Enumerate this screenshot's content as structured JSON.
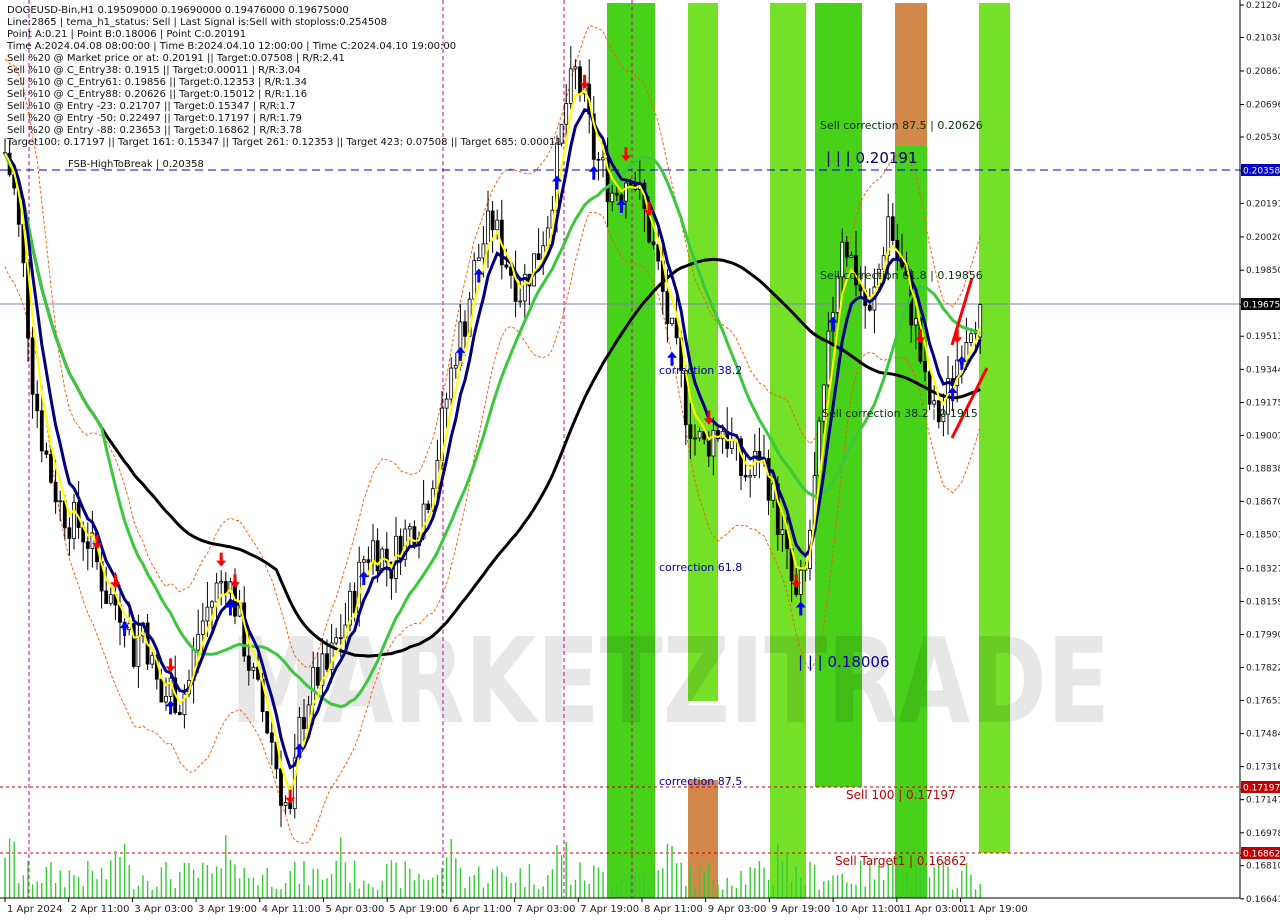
{
  "header": {
    "lines": [
      "DOGEUSD-Bin,H1  0.19509000 0.19690000 0.19476000 0.19675000",
      "Line:2865 | tema_h1_status: Sell | Last Signal is:Sell with stoploss:0.254508",
      "Point A:0.21 | Point B:0.18006 | Point C:0.20191",
      "Time A:2024.04.08 08:00:00 | Time B:2024.04.10 12:00:00 | Time C:2024.04.10 19:00:00",
      "Sell %20 @ Market price or at: 0.20191 || Target:0.07508 | R/R:2.41",
      "Sell %10 @ C_Entry38: 0.1915 || Target:0.00011 | R/R:3.04",
      "Sell %10 @ C_Entry61: 0.19856 || Target:0.12353 | R/R:1.34",
      "Sell %10 @ C_Entry88: 0.20626 || Target:0.15012 | R/R:1.16",
      "Sell %10 @ Entry -23: 0.21707 || Target:0.15347 | R/R:1.7",
      "Sell %20 @ Entry -50: 0.22497 || Target:0.17197 | R/R:1.79",
      "Sell %20 @ Entry -88: 0.23653 || Target:0.16862 | R/R:3.78",
      "Target100: 0.17197 || Target 161: 0.15347 || Target 261: 0.12353 || Target 423: 0.07508 || Target 685: 0.00011"
    ]
  },
  "annotations": {
    "fsb": "FSB-HighToBreak | 0.20358",
    "point_c": "| | | 0.20191",
    "point_b": "| | | 0.18006",
    "sell_corr_875": "Sell correction 87.5 | 0.20626",
    "sell_corr_618": "Sell correction 61.8 | 0.19856",
    "sell_corr_382": "Sell correction 38.2 | 0.1915",
    "corr_382": "correction 38.2",
    "corr_618": "correction 61.8",
    "corr_875": "correction 87.5",
    "sell_100": "Sell 100 | 0.17197",
    "sell_target1": "Sell Target1 | 0.16862",
    "watermark": "MARKETZITRADE"
  },
  "colors": {
    "background": "#ffffff",
    "bull_candle": "#000000",
    "bear_candle": "#000000",
    "zone_green": "#33cc00",
    "zone_light_green": "#66dd11",
    "zone_orange": "#d2884a",
    "ma_black": "#000000",
    "ma_navy": "#000080",
    "ma_green": "#3cc83c",
    "ma_yellow": "#ffff00",
    "envelope_orange": "#ff5500",
    "dashed_blue": "#0000cc",
    "sell_line": "#c00000",
    "arrow_up": "#0000ff",
    "arrow_down": "#ff0000",
    "price_tag": "#333333",
    "current_tag": "#000000",
    "fsb_tag": "#0000cc",
    "red_tag": "#c00000"
  },
  "chart_data": {
    "type": "candlestick",
    "symbol": "DOGEUSD-Bin",
    "timeframe": "H1",
    "ylim": [
      0.16645,
      0.21204
    ],
    "y_ticks": [
      "0.21204",
      "0.21038",
      "0.20867",
      "0.20696",
      "0.20530",
      "0.20358",
      "0.20191",
      "0.20020",
      "0.19850",
      "0.19675",
      "0.19513",
      "0.19344",
      "0.19175",
      "0.19007",
      "0.18838",
      "0.18670",
      "0.18501",
      "0.18327",
      "0.18159",
      "0.17990",
      "0.17822",
      "0.17653",
      "0.17484",
      "0.17316",
      "0.17197",
      "0.17147",
      "0.16978",
      "0.16862",
      "0.16810",
      "0.16641"
    ],
    "y_tick_values": [
      0.21204,
      0.21038,
      0.20867,
      0.20696,
      0.2053,
      0.20358,
      0.20191,
      0.2002,
      0.1985,
      0.19675,
      0.19513,
      0.19344,
      0.19175,
      0.19007,
      0.18838,
      0.1867,
      0.18501,
      0.18327,
      0.18159,
      0.1799,
      0.17822,
      0.17653,
      0.17484,
      0.17316,
      0.17197,
      0.17147,
      0.16978,
      0.16862,
      0.1681,
      0.16641
    ],
    "x_ticks": [
      "1 Apr 2024",
      "2 Apr 11:00",
      "3 Apr 03:00",
      "3 Apr 19:00",
      "4 Apr 11:00",
      "5 Apr 03:00",
      "5 Apr 19:00",
      "6 Apr 11:00",
      "7 Apr 03:00",
      "7 Apr 19:00",
      "8 Apr 11:00",
      "9 Apr 03:00",
      "9 Apr 19:00",
      "10 Apr 11:00",
      "11 Apr 03:00",
      "11 Apr 19:00"
    ],
    "price_levels": {
      "fsb_high_to_break": 0.20358,
      "point_a": 0.21,
      "point_b": 0.18006,
      "point_c": 0.20191,
      "current_price": 0.19675,
      "sell_100": 0.17197,
      "sell_target1": 0.16862
    },
    "ohlc_last": {
      "open": 0.19509,
      "high": 0.1969,
      "low": 0.19476,
      "close": 0.19675
    },
    "price_path": [
      [
        0,
        0.2045
      ],
      [
        2,
        0.2025
      ],
      [
        4,
        0.1985
      ],
      [
        6,
        0.193
      ],
      [
        8,
        0.19
      ],
      [
        10,
        0.188
      ],
      [
        12,
        0.1865
      ],
      [
        14,
        0.1858
      ],
      [
        16,
        0.1855
      ],
      [
        18,
        0.1848
      ],
      [
        20,
        0.1835
      ],
      [
        22,
        0.182
      ],
      [
        24,
        0.1815
      ],
      [
        26,
        0.1812
      ],
      [
        28,
        0.179
      ],
      [
        30,
        0.1805
      ],
      [
        32,
        0.1782
      ],
      [
        34,
        0.1765
      ],
      [
        36,
        0.1772
      ],
      [
        38,
        0.1765
      ],
      [
        40,
        0.1775
      ],
      [
        42,
        0.18
      ],
      [
        44,
        0.1812
      ],
      [
        46,
        0.1822
      ],
      [
        48,
        0.183
      ],
      [
        50,
        0.1815
      ],
      [
        52,
        0.1795
      ],
      [
        54,
        0.1775
      ],
      [
        56,
        0.176
      ],
      [
        58,
        0.1745
      ],
      [
        60,
        0.172
      ],
      [
        62,
        0.1705
      ],
      [
        64,
        0.175
      ],
      [
        66,
        0.1768
      ],
      [
        68,
        0.1778
      ],
      [
        70,
        0.178
      ],
      [
        72,
        0.1795
      ],
      [
        74,
        0.1805
      ],
      [
        76,
        0.182
      ],
      [
        78,
        0.1838
      ],
      [
        80,
        0.1845
      ],
      [
        82,
        0.184
      ],
      [
        84,
        0.1835
      ],
      [
        86,
        0.1848
      ],
      [
        88,
        0.1852
      ],
      [
        90,
        0.1858
      ],
      [
        92,
        0.1872
      ],
      [
        94,
        0.1892
      ],
      [
        96,
        0.192
      ],
      [
        98,
        0.1945
      ],
      [
        100,
        0.196
      ],
      [
        102,
        0.1985
      ],
      [
        104,
        0.2
      ],
      [
        106,
        0.201
      ],
      [
        108,
        0.1995
      ],
      [
        110,
        0.1985
      ],
      [
        112,
        0.1975
      ],
      [
        114,
        0.1985
      ],
      [
        116,
        0.1995
      ],
      [
        118,
        0.2012
      ],
      [
        120,
        0.204
      ],
      [
        122,
        0.207
      ],
      [
        124,
        0.2085
      ],
      [
        126,
        0.207
      ],
      [
        128,
        0.2045
      ],
      [
        130,
        0.2035
      ],
      [
        132,
        0.2025
      ],
      [
        134,
        0.2028
      ],
      [
        136,
        0.2038
      ],
      [
        138,
        0.2022
      ],
      [
        140,
        0.2005
      ],
      [
        142,
        0.1985
      ],
      [
        144,
        0.196
      ],
      [
        146,
        0.194
      ],
      [
        148,
        0.1915
      ],
      [
        150,
        0.19
      ],
      [
        152,
        0.1895
      ],
      [
        154,
        0.1902
      ],
      [
        156,
        0.1905
      ],
      [
        158,
        0.1895
      ],
      [
        160,
        0.1882
      ],
      [
        162,
        0.188
      ],
      [
        164,
        0.1892
      ],
      [
        166,
        0.1878
      ],
      [
        168,
        0.1858
      ],
      [
        170,
        0.1835
      ],
      [
        172,
        0.1815
      ],
      [
        174,
        0.183
      ],
      [
        176,
        0.1875
      ],
      [
        178,
        0.192
      ],
      [
        180,
        0.1968
      ],
      [
        182,
        0.2005
      ],
      [
        184,
        0.199
      ],
      [
        186,
        0.1975
      ],
      [
        188,
        0.196
      ],
      [
        190,
        0.1985
      ],
      [
        192,
        0.2012
      ],
      [
        194,
        0.1992
      ],
      [
        196,
        0.1975
      ],
      [
        198,
        0.1955
      ],
      [
        200,
        0.1925
      ],
      [
        202,
        0.191
      ],
      [
        204,
        0.1912
      ],
      [
        206,
        0.1932
      ],
      [
        208,
        0.1948
      ],
      [
        210,
        0.1962
      ],
      [
        212,
        0.1968
      ]
    ]
  }
}
